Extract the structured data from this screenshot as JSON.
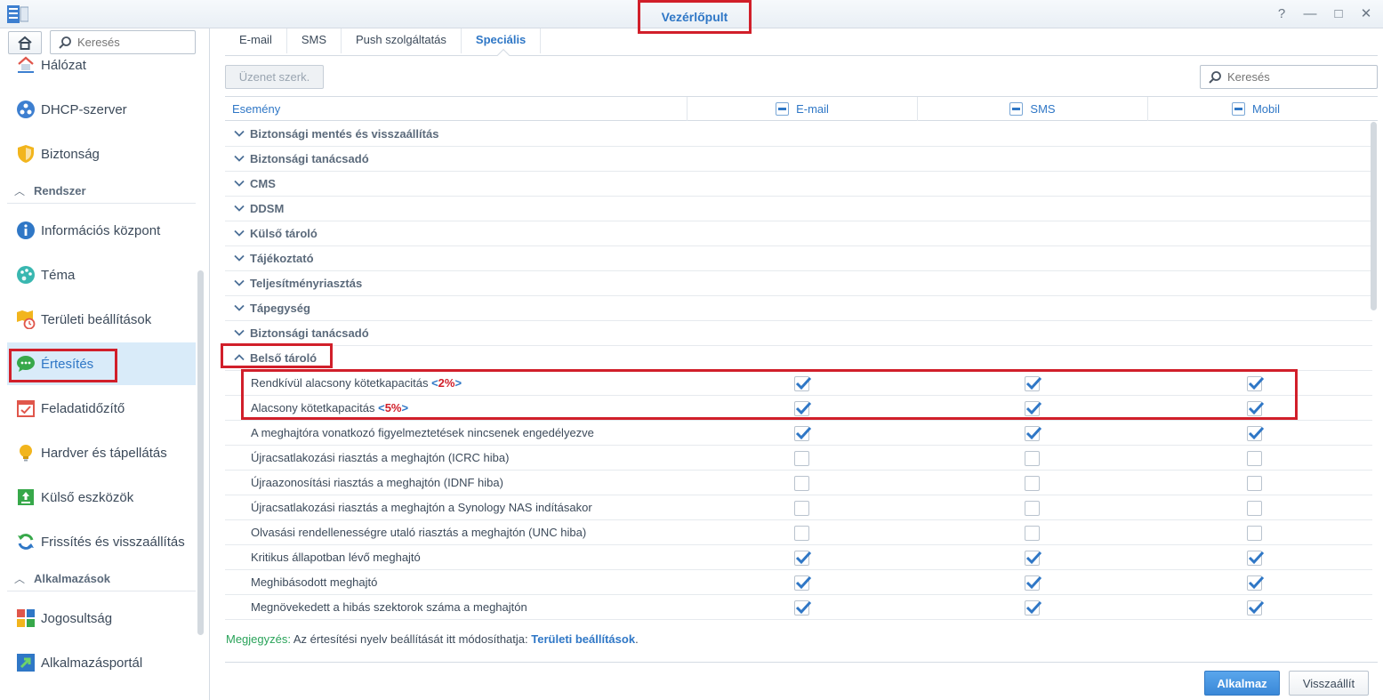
{
  "window": {
    "title": "Vezérlőpult",
    "controls": [
      "?",
      "—",
      "□",
      "✕"
    ]
  },
  "sidebar": {
    "search_placeholder": "Keresés",
    "items_top": [
      {
        "label": "Hálózat",
        "icon": "network-icon"
      },
      {
        "label": "DHCP-szerver",
        "icon": "dhcp-icon"
      },
      {
        "label": "Biztonság",
        "icon": "shield-icon"
      }
    ],
    "group_system": "Rendszer",
    "items_system": [
      {
        "label": "Információs központ",
        "icon": "info-icon"
      },
      {
        "label": "Téma",
        "icon": "palette-icon"
      },
      {
        "label": "Területi beállítások",
        "icon": "regional-icon"
      },
      {
        "label": "Értesítés",
        "icon": "chat-icon"
      },
      {
        "label": "Feladatidőzítő",
        "icon": "calendar-icon"
      },
      {
        "label": "Hardver és tápellátás",
        "icon": "bulb-icon"
      },
      {
        "label": "Külső eszközök",
        "icon": "external-icon"
      },
      {
        "label": "Frissítés és visszaállítás",
        "icon": "refresh-icon"
      }
    ],
    "group_apps": "Alkalmazások",
    "items_apps": [
      {
        "label": "Jogosultság",
        "icon": "grid-icon"
      },
      {
        "label": "Alkalmazásportál",
        "icon": "portal-icon"
      }
    ],
    "active": "Értesítés"
  },
  "tabs": [
    "E-mail",
    "SMS",
    "Push szolgáltatás",
    "Speciális"
  ],
  "active_tab": "Speciális",
  "toolbar": {
    "edit_label": "Üzenet szerk.",
    "search_placeholder": "Keresés"
  },
  "grid": {
    "headers": {
      "event": "Esemény",
      "email": "E-mail",
      "sms": "SMS",
      "mobile": "Mobil"
    },
    "groups": [
      "Biztonsági mentés és visszaállítás",
      "Biztonsági tanácsadó",
      "CMS",
      "DDSM",
      "Külső tároló",
      "Tájékoztató",
      "Teljesítményriasztás",
      "Tápegység",
      "Biztonsági tanácsadó"
    ],
    "expanded_group": "Belső tároló",
    "items": [
      {
        "label": "Rendkívül alacsony kötetkapacitás",
        "thr_open": "<",
        "thr_val": "2%",
        "thr_close": ">",
        "email": true,
        "sms": true,
        "mobile": true
      },
      {
        "label": "Alacsony kötetkapacitás",
        "thr_open": "<",
        "thr_val": "5%",
        "thr_close": ">",
        "email": true,
        "sms": true,
        "mobile": true
      },
      {
        "label": "A meghajtóra vonatkozó figyelmeztetések nincsenek engedélyezve",
        "email": true,
        "sms": true,
        "mobile": true
      },
      {
        "label": "Újracsatlakozási riasztás a meghajtón (ICRC hiba)",
        "email": false,
        "sms": false,
        "mobile": false
      },
      {
        "label": "Újraazonosítási riasztás a meghajtón (IDNF hiba)",
        "email": false,
        "sms": false,
        "mobile": false
      },
      {
        "label": "Újracsatlakozási riasztás a meghajtón a Synology NAS indításakor",
        "email": false,
        "sms": false,
        "mobile": false
      },
      {
        "label": "Olvasási rendellenességre utaló riasztás a meghajtón (UNC hiba)",
        "email": false,
        "sms": false,
        "mobile": false
      },
      {
        "label": "Kritikus állapotban lévő meghajtó",
        "email": true,
        "sms": true,
        "mobile": true
      },
      {
        "label": "Meghibásodott meghajtó",
        "email": true,
        "sms": true,
        "mobile": true
      },
      {
        "label": "Megnövekedett a hibás szektorok száma a meghajtón",
        "email": true,
        "sms": true,
        "mobile": true
      }
    ]
  },
  "note": {
    "label": "Megjegyzés:",
    "text": "Az értesítési nyelv beállítását itt módosíthatja:",
    "link": "Területi beállítások",
    "end": "."
  },
  "buttons": {
    "apply": "Alkalmaz",
    "reset": "Visszaállít"
  },
  "colors": {
    "accent": "#2f77c6",
    "highlight": "#d11f2a",
    "check": "#2f77c6"
  }
}
